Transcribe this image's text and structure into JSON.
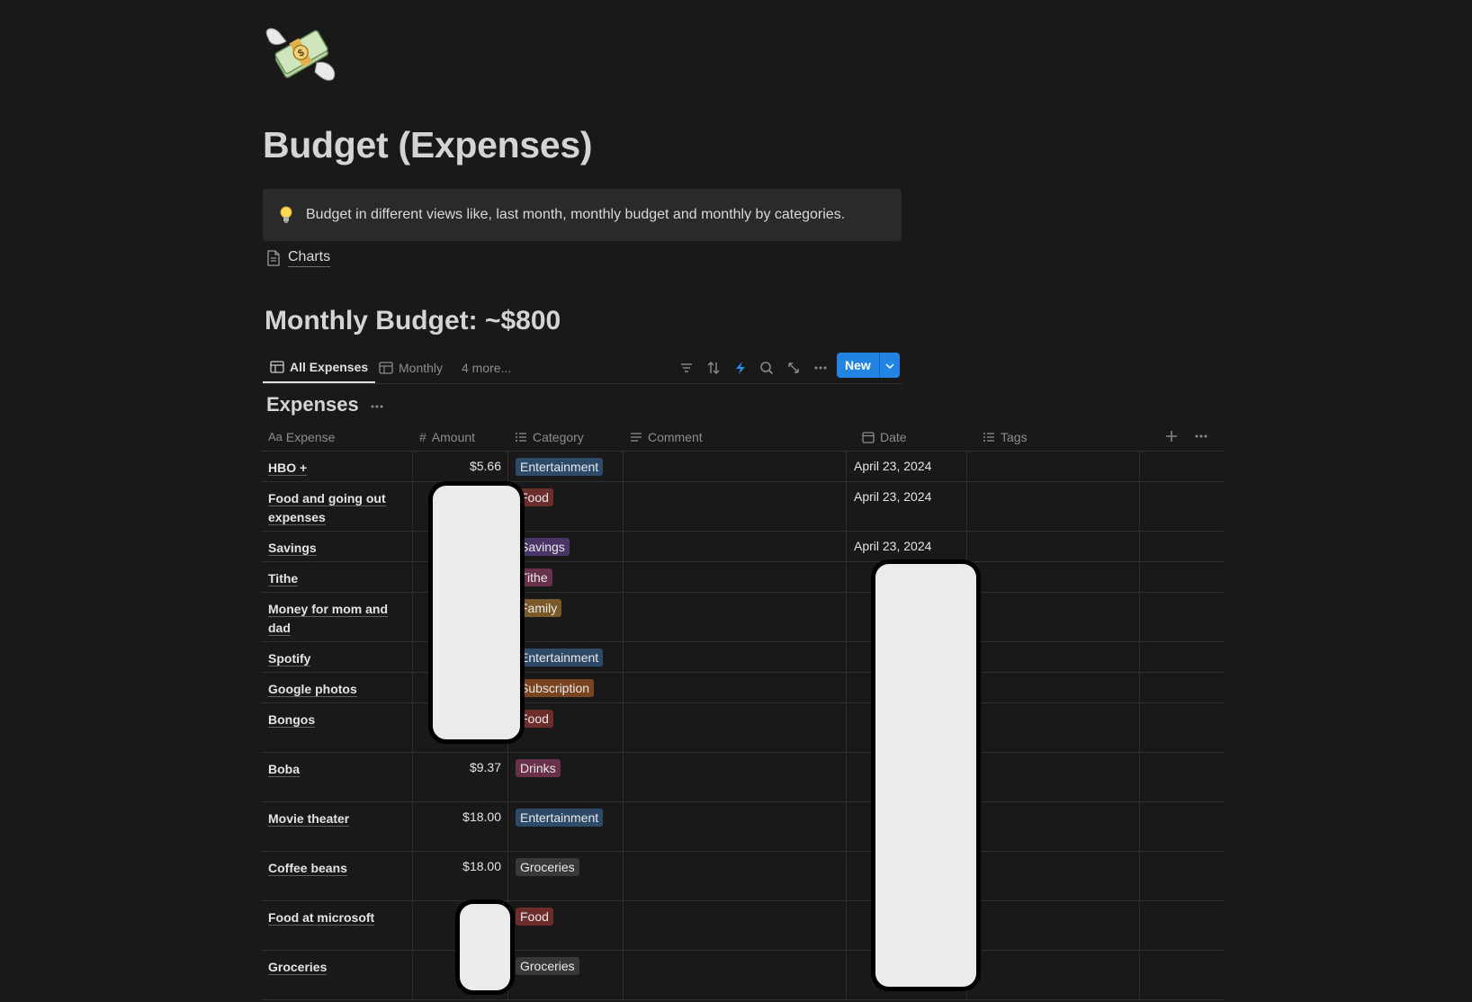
{
  "page": {
    "icon": "money-with-wings-icon",
    "title": "Budget (Expenses)",
    "callout": {
      "icon": "lightbulb-icon",
      "text": "Budget in different views like, last month, monthly budget and monthly by categories."
    },
    "link": {
      "icon": "page-icon",
      "label": "Charts"
    },
    "section_heading": "Monthly Budget: ~$800"
  },
  "views": {
    "tabs": [
      {
        "label": "All Expenses",
        "icon": "table-icon",
        "active": true
      },
      {
        "label": "Monthly",
        "icon": "table-icon",
        "active": false
      },
      {
        "label": "4 more...",
        "icon": "",
        "active": false
      }
    ],
    "tools": [
      "filter-icon",
      "sort-icon",
      "automation-icon",
      "search-icon",
      "expand-icon",
      "more-icon"
    ],
    "new_label": "New"
  },
  "database": {
    "title": "Expenses",
    "columns": [
      {
        "label": "Expense",
        "icon": "Aa"
      },
      {
        "label": "Amount",
        "icon": "#"
      },
      {
        "label": "Category",
        "icon": "list-icon"
      },
      {
        "label": "Comment",
        "icon": "text-icon"
      },
      {
        "label": "Date",
        "icon": "calendar-icon"
      },
      {
        "label": "Tags",
        "icon": "list-icon"
      }
    ],
    "rows": [
      {
        "expense": "HBO +",
        "amount": "$5.66",
        "category": "Entertainment",
        "date": "April 23, 2024"
      },
      {
        "expense": "Food and going out expenses",
        "amount": "",
        "category": "Food",
        "date": "April 23, 2024"
      },
      {
        "expense": "Savings",
        "amount": "",
        "category": "Savings",
        "date": "April 23, 2024"
      },
      {
        "expense": "Tithe",
        "amount": "",
        "category": "Tithe",
        "date": ""
      },
      {
        "expense": "Money for mom and dad",
        "amount": "",
        "category": "Family",
        "date": ""
      },
      {
        "expense": "Spotify",
        "amount": "",
        "category": "Entertainment",
        "date": ""
      },
      {
        "expense": "Google photos",
        "amount": "",
        "category": "Subscription",
        "date": ""
      },
      {
        "expense": "Bongos",
        "amount": "",
        "category": "Food",
        "date": ""
      },
      {
        "expense": "Boba",
        "amount": "$9.37",
        "category": "Drinks",
        "date": ""
      },
      {
        "expense": "Movie theater",
        "amount": "$18.00",
        "category": "Entertainment",
        "date": ""
      },
      {
        "expense": "Coffee beans",
        "amount": "$18.00",
        "category": "Groceries",
        "date": ""
      },
      {
        "expense": "Food at microsoft",
        "amount": "",
        "category": "Food",
        "date": ""
      },
      {
        "expense": "Groceries",
        "amount": "",
        "category": "Groceries",
        "date": ""
      }
    ],
    "category_colors": {
      "Entertainment": "#2e4a69",
      "Food": "#6e2d2d",
      "Savings": "#4a3566",
      "Tithe": "#69314a",
      "Family": "#7a5a2a",
      "Subscription": "#7a4420",
      "Drinks": "#69314a",
      "Groceries": "#383838"
    }
  },
  "colors": {
    "background": "#191919",
    "accent": "#2383e2",
    "callout_bg": "#2a2a2a"
  }
}
